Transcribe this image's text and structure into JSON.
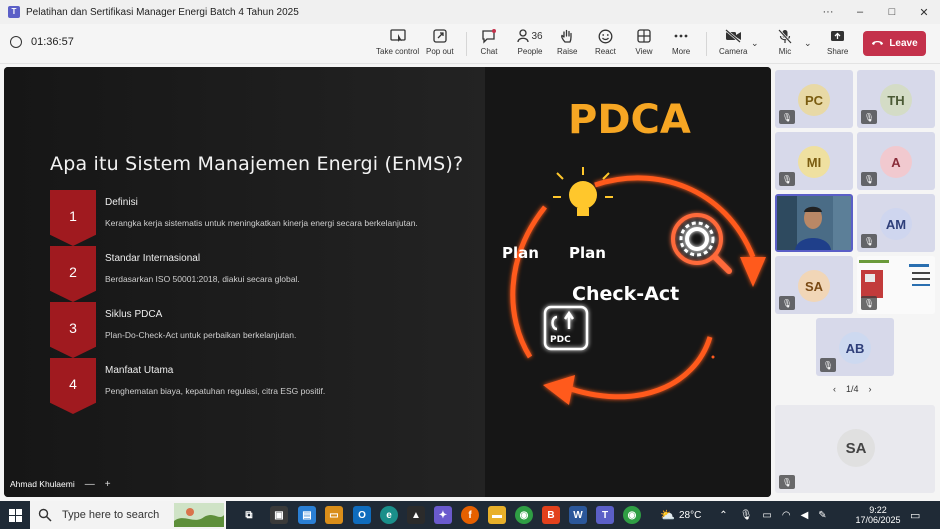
{
  "window": {
    "title": "Pelatihan dan Sertifikasi Manager Energi Batch 4 Tahun 2025",
    "controls": [
      "···",
      "–",
      "□",
      "✕"
    ]
  },
  "meeting": {
    "timer": "01:36:57",
    "buttons": [
      {
        "label": "Take control",
        "icon": "take-control-icon"
      },
      {
        "label": "Pop out",
        "icon": "pop-out-icon"
      },
      {
        "label": "Chat",
        "icon": "chat-icon"
      },
      {
        "label": "People",
        "icon": "people-icon",
        "count": "36"
      },
      {
        "label": "Raise",
        "icon": "raise-hand-icon"
      },
      {
        "label": "React",
        "icon": "react-icon"
      },
      {
        "label": "View",
        "icon": "view-icon"
      },
      {
        "label": "More",
        "icon": "more-icon"
      },
      {
        "label": "Camera",
        "icon": "camera-off-icon"
      },
      {
        "label": "Mic",
        "icon": "mic-off-icon"
      },
      {
        "label": "Share",
        "icon": "share-icon"
      }
    ],
    "leave_label": "Leave"
  },
  "slide": {
    "title": "Apa itu Sistem Manajemen Energi (EnMS)?",
    "items": [
      {
        "num": "1",
        "heading": "Definisi",
        "desc": "Kerangka kerja sistematis untuk meningkatkan kinerja energi secara berkelanjutan."
      },
      {
        "num": "2",
        "heading": "Standar Internasional",
        "desc": "Berdasarkan ISO 50001:2018, diakui secara global."
      },
      {
        "num": "3",
        "heading": "Siklus PDCA",
        "desc": "Plan-Do-Check-Act untuk perbaikan berkelanjutan."
      },
      {
        "num": "4",
        "heading": "Manfaat Utama",
        "desc": "Penghematan biaya, kepatuhan regulasi, citra ESG positif."
      }
    ],
    "pdca": {
      "title": "PDCA",
      "plan_left": "Plan",
      "plan_right": "Plan",
      "check_act": "Check-Act",
      "pdc_label": "PDC"
    },
    "colors": {
      "accent": "#a01a1f",
      "pdca": "#f6a623",
      "glow": "#ff5a1f"
    }
  },
  "presenter": {
    "name": "Ahmad Khulaemi",
    "controls": [
      "—",
      "+"
    ]
  },
  "participants": [
    {
      "initials": "PC",
      "color": "#e8d9a6",
      "text_color": "#7a5c10"
    },
    {
      "initials": "TH",
      "color": "#d4dcc6",
      "text_color": "#4b5a35"
    },
    {
      "initials": "MI",
      "color": "#efe0a0",
      "text_color": "#7a5c10"
    },
    {
      "initials": "A",
      "color": "#f1c9cf",
      "text_color": "#8a2c3a"
    },
    {
      "initials": "",
      "video": true
    },
    {
      "initials": "AM",
      "color": "#cfd6ef",
      "text_color": "#2f3f7a"
    },
    {
      "initials": "SA",
      "color": "#f1d6b7",
      "text_color": "#7a4a15"
    },
    {
      "initials": "",
      "screenshare": true
    },
    {
      "initials": "AB",
      "color": "#cdd9f0",
      "text_color": "#2f3f7a"
    }
  ],
  "pager": {
    "label": "1/4",
    "prev": "‹",
    "next": "›"
  },
  "solo_tile": {
    "initials": "SA"
  },
  "taskbar": {
    "search_placeholder": "Type here to search",
    "weather": "28°C",
    "time": "9:22",
    "date": "17/06/2025"
  }
}
